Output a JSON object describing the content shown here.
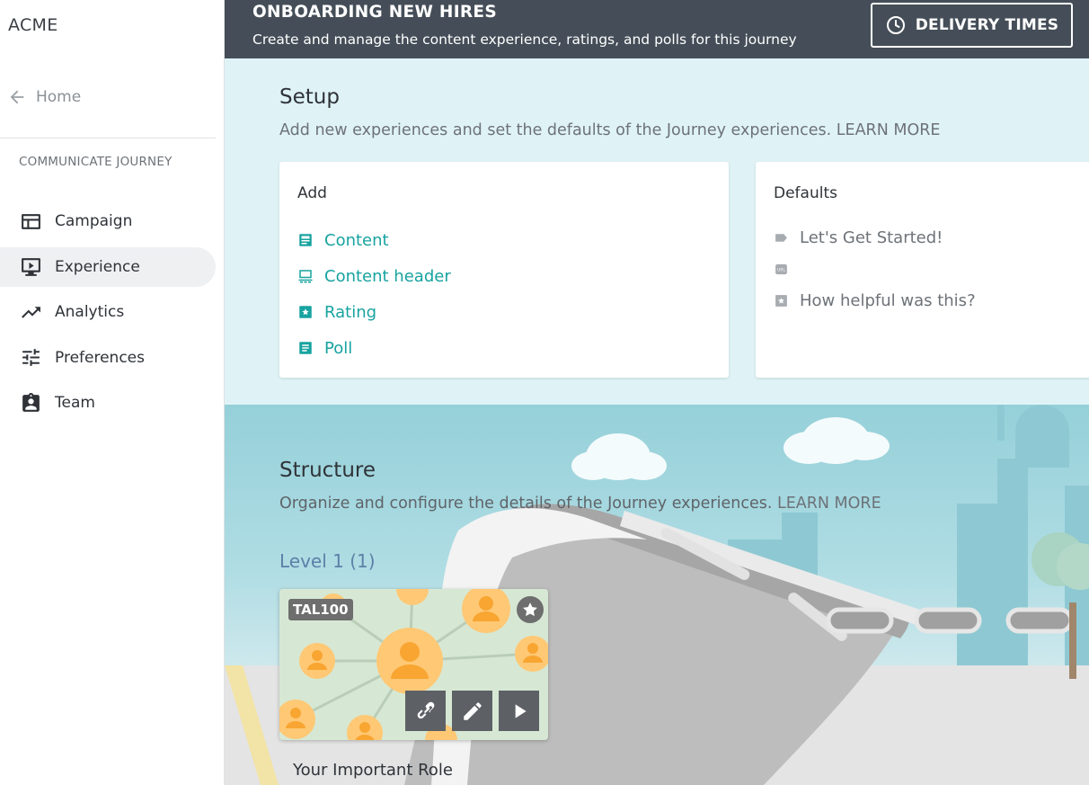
{
  "sidebar": {
    "brand": "ACME",
    "home_label": "Home",
    "section_label": "COMMUNICATE JOURNEY",
    "items": [
      {
        "label": "Campaign",
        "icon": "campaign-icon",
        "active": false
      },
      {
        "label": "Experience",
        "icon": "experience-icon",
        "active": true
      },
      {
        "label": "Analytics",
        "icon": "analytics-icon",
        "active": false
      },
      {
        "label": "Preferences",
        "icon": "preferences-icon",
        "active": false
      },
      {
        "label": "Team",
        "icon": "team-icon",
        "active": false
      }
    ]
  },
  "header": {
    "title": "ONBOARDING NEW HIRES",
    "subtitle": "Create and manage the content experience, ratings, and polls for this journey",
    "delivery_button": "DELIVERY TIMES"
  },
  "setup": {
    "title": "Setup",
    "description": "Add new experiences and set the defaults of the Journey experiences.",
    "learn_more": "LEARN MORE",
    "add": {
      "title": "Add",
      "items": [
        {
          "label": "Content",
          "icon": "content-icon"
        },
        {
          "label": "Content header",
          "icon": "content-header-icon"
        },
        {
          "label": "Rating",
          "icon": "rating-icon"
        },
        {
          "label": "Poll",
          "icon": "poll-icon"
        }
      ]
    },
    "defaults": {
      "title": "Defaults",
      "items": [
        {
          "label": "Let's Get Started!",
          "icon": "label-icon"
        },
        {
          "label": "",
          "icon": "url-icon"
        },
        {
          "label": "How helpful was this?",
          "icon": "rating-icon"
        }
      ]
    }
  },
  "structure": {
    "title": "Structure",
    "description": "Organize and configure the details of the Journey experiences.",
    "learn_more": "LEARN MORE",
    "level_label": "Level 1 (1)",
    "experience": {
      "code": "TAL100",
      "name": "Your Important Role"
    }
  },
  "colors": {
    "header_bg": "#454e58",
    "setup_bg": "#dff3f6",
    "accent_teal": "#18a3a0",
    "level_blue": "#5c81a8",
    "active_nav_bg": "#eef0f2"
  }
}
